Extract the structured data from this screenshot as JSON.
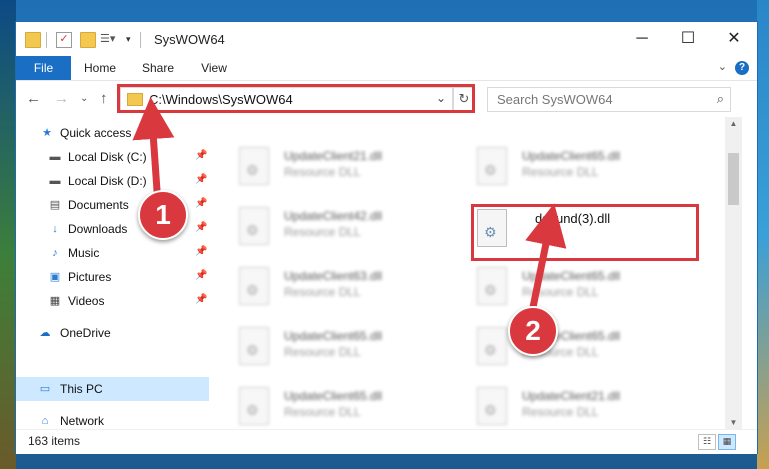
{
  "window": {
    "title": "SysWOW64"
  },
  "ribbon": {
    "tabs": [
      "File",
      "Home",
      "Share",
      "View"
    ],
    "help": "?"
  },
  "nav": {
    "address": "C:\\Windows\\SysWOW64",
    "search_placeholder": "Search SysWOW64"
  },
  "sidebar": {
    "items": [
      {
        "label": "Quick access",
        "icon": "star-icon"
      },
      {
        "label": "Local Disk (C:)",
        "icon": "drive-icon"
      },
      {
        "label": "Local Disk (D:)",
        "icon": "drive-icon"
      },
      {
        "label": "Documents",
        "icon": "documents-icon"
      },
      {
        "label": "Downloads",
        "icon": "download-icon"
      },
      {
        "label": "Music",
        "icon": "music-icon"
      },
      {
        "label": "Pictures",
        "icon": "pictures-icon"
      },
      {
        "label": "Videos",
        "icon": "videos-icon"
      },
      {
        "label": "OneDrive",
        "icon": "cloud-icon"
      },
      {
        "label": "This PC",
        "icon": "computer-icon"
      },
      {
        "label": "Network",
        "icon": "network-icon"
      }
    ]
  },
  "files": {
    "left": [
      {
        "name": "UpdateClient21.dll",
        "type": "Resource DLL"
      },
      {
        "name": "UpdateClient42.dll",
        "type": "Resource DLL"
      },
      {
        "name": "UpdateClient63.dll",
        "type": "Resource DLL"
      },
      {
        "name": "UpdateClient65.dll",
        "type": "Resource DLL"
      },
      {
        "name": "UpdateClient65.dll",
        "type": "Resource DLL"
      }
    ],
    "right": [
      {
        "name": "UpdateClient65.dll",
        "type": "Resource DLL"
      },
      {
        "name": "dsound(3).dll",
        "type": ""
      },
      {
        "name": "UpdateClient65.dll",
        "type": "Resource DLL"
      },
      {
        "name": "UpdateClient65.dll",
        "type": "Resource DLL"
      },
      {
        "name": "UpdateClient21.dll",
        "type": "Resource DLL"
      }
    ]
  },
  "status": {
    "count": "163 items"
  },
  "annotations": {
    "badge1": "1",
    "badge2": "2"
  },
  "colors": {
    "accent": "#1a6fc4",
    "highlight": "#d9383f",
    "selected": "#cde8ff"
  }
}
